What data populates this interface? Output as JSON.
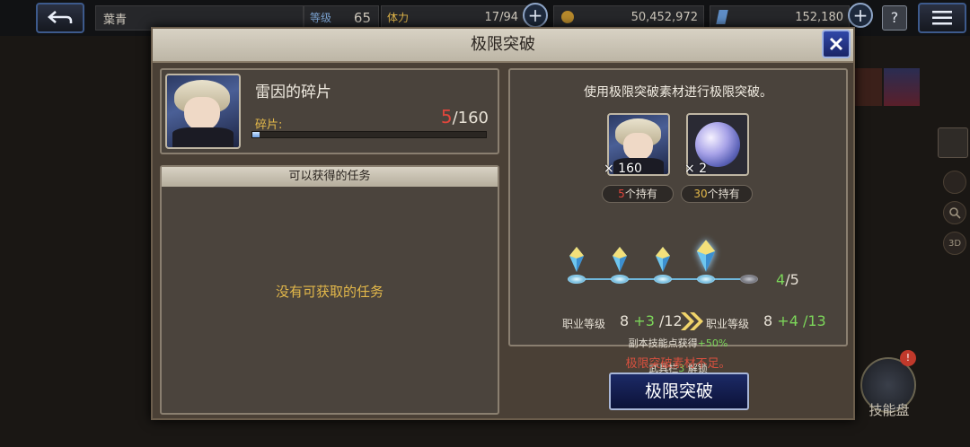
{
  "topbar": {
    "player_name": "葉青",
    "level_label": "等级",
    "level_value": "65",
    "stamina_label": "体力",
    "stamina_value": "17/94",
    "gil_value": "50,452,972",
    "gems_value": "152,180",
    "help_label": "?"
  },
  "modal": {
    "title": "极限突破",
    "fragment": {
      "name": "雷因的碎片",
      "label": "碎片:",
      "current": "5",
      "required": "/160",
      "progress_fraction": 0.03125
    },
    "quests": {
      "header": "可以获得的任务",
      "empty_text": "没有可获取的任务"
    },
    "limit": {
      "description": "使用极限突破素材进行极限突破。",
      "materials": [
        {
          "icon": "character-portrait-icon",
          "cost": "× 160",
          "owned_num": "5",
          "owned_label": "个持有",
          "owned_color": "#e0463c"
        },
        {
          "icon": "orb-icon",
          "cost": "× 2",
          "owned_num": "30",
          "owned_label": "个持有",
          "owned_color": "#e3b84a"
        }
      ],
      "stage_current": "4",
      "stage_total": "/5",
      "stage_count": 5,
      "stages_unlocked": 4,
      "job_label": "职业等级",
      "before": {
        "base": "8",
        "bonus": "+3",
        "max": "/12"
      },
      "after": {
        "base": "8",
        "bonus": "+4",
        "max": "/13"
      },
      "note_prefix": "副本技能点获得",
      "note_bonus": "+50%",
      "weapon_prefix": "武具栏",
      "weapon_num": "3",
      "weapon_suffix": " 解锁",
      "warning": "极限突破素材不足。",
      "button": "极限突破"
    }
  },
  "side": {
    "skill_board": "技能盘",
    "skill_board_badge": "!",
    "view_3d": "3D"
  },
  "colors": {
    "accent_green": "#7cd65a",
    "accent_red": "#e0463c",
    "accent_gold": "#e3b84a",
    "warning": "#d9503f"
  }
}
